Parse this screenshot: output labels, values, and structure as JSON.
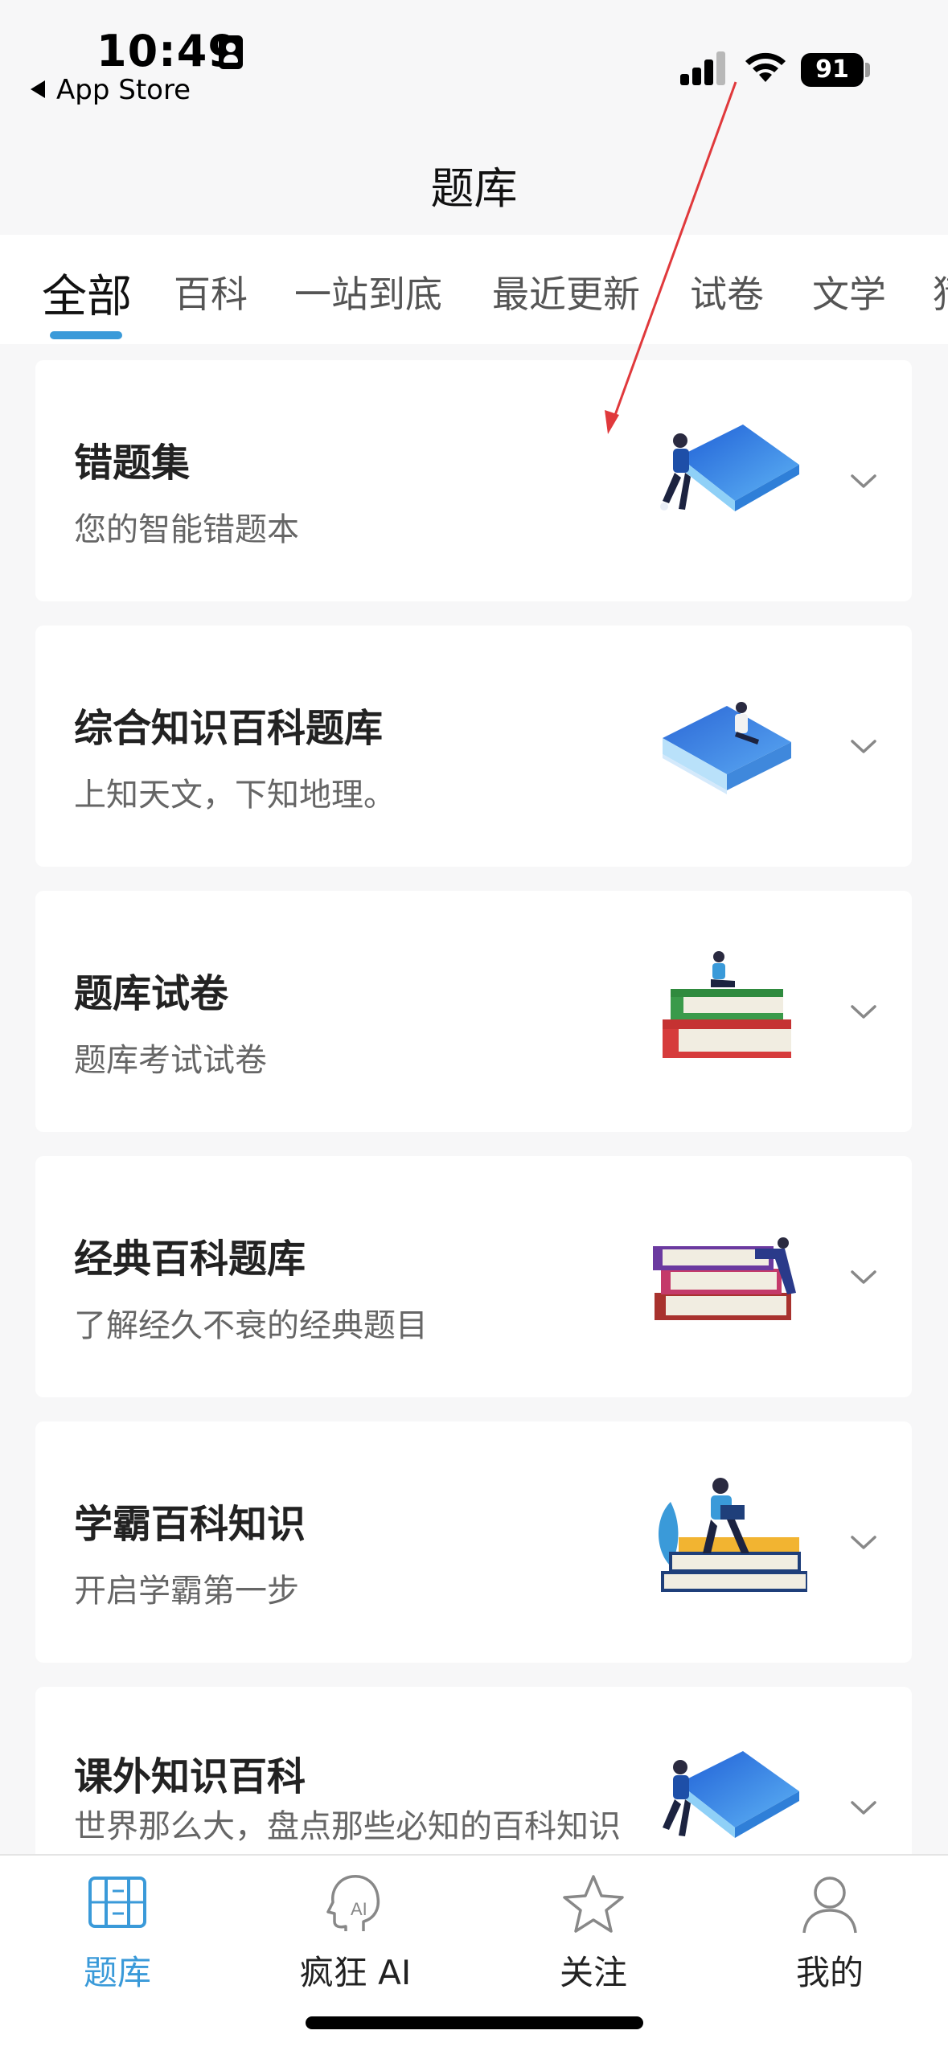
{
  "status_bar": {
    "time": "10:49",
    "back_label": "App Store",
    "battery": "91"
  },
  "header": {
    "title": "题库"
  },
  "tabs": [
    {
      "label": "全部",
      "active": true
    },
    {
      "label": "百科"
    },
    {
      "label": "一站到底"
    },
    {
      "label": "最近更新"
    },
    {
      "label": "试卷"
    },
    {
      "label": "文学"
    },
    {
      "label": "猜"
    }
  ],
  "cards": [
    {
      "title": "错题集",
      "subtitle": "您的智能错题本",
      "illustration": "person-sitting-on-book"
    },
    {
      "title": "综合知识百科题库",
      "subtitle": "上知天文，下知地理。",
      "illustration": "person-on-book-stack"
    },
    {
      "title": "题库试卷",
      "subtitle": "题库考试试卷",
      "illustration": "person-reading-on-books"
    },
    {
      "title": "经典百科题库",
      "subtitle": "了解经久不衰的经典题目",
      "illustration": "person-lying-on-books"
    },
    {
      "title": "学霸百科知识",
      "subtitle": "开启学霸第一步",
      "illustration": "person-with-laptop-on-books"
    },
    {
      "title": "课外知识百科",
      "subtitle": "世界那么大，盘点那些必知的百科知识",
      "illustration": "person-sitting-on-book"
    }
  ],
  "tabbar": [
    {
      "label": "题库",
      "icon": "book-icon",
      "active": true
    },
    {
      "label": "疯狂 AI",
      "icon": "ai-head-icon"
    },
    {
      "label": "关注",
      "icon": "star-icon"
    },
    {
      "label": "我的",
      "icon": "user-icon"
    }
  ],
  "colors": {
    "accent": "#3a9ad9",
    "annotation_arrow": "#e0393c"
  }
}
